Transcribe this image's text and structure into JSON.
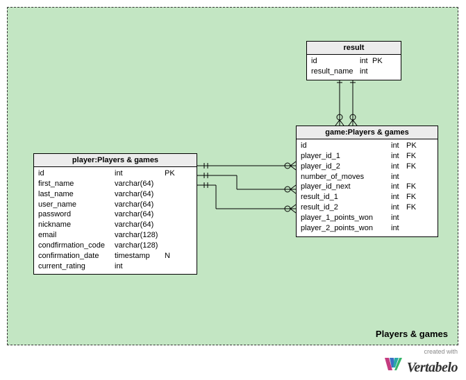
{
  "area": {
    "label": "Players & games"
  },
  "entities": {
    "result": {
      "title": "result",
      "columns": [
        {
          "name": "id",
          "type": "int",
          "flag": "PK"
        },
        {
          "name": "result_name",
          "type": "int",
          "flag": ""
        }
      ]
    },
    "player": {
      "title": "player:Players & games",
      "columns": [
        {
          "name": "id",
          "type": "int",
          "flag": "PK"
        },
        {
          "name": "first_name",
          "type": "varchar(64)",
          "flag": ""
        },
        {
          "name": "last_name",
          "type": "varchar(64)",
          "flag": ""
        },
        {
          "name": "user_name",
          "type": "varchar(64)",
          "flag": ""
        },
        {
          "name": "password",
          "type": "varchar(64)",
          "flag": ""
        },
        {
          "name": "nickname",
          "type": "varchar(64)",
          "flag": ""
        },
        {
          "name": "email",
          "type": "varchar(128)",
          "flag": ""
        },
        {
          "name": "condfirmation_code",
          "type": "varchar(128)",
          "flag": ""
        },
        {
          "name": "confirmation_date",
          "type": "timestamp",
          "flag": "N"
        },
        {
          "name": "current_rating",
          "type": "int",
          "flag": ""
        }
      ]
    },
    "game": {
      "title": "game:Players & games",
      "columns": [
        {
          "name": "id",
          "type": "int",
          "flag": "PK"
        },
        {
          "name": "player_id_1",
          "type": "int",
          "flag": "FK"
        },
        {
          "name": "player_id_2",
          "type": "int",
          "flag": "FK"
        },
        {
          "name": "number_of_moves",
          "type": "int",
          "flag": ""
        },
        {
          "name": "player_id_next",
          "type": "int",
          "flag": "FK"
        },
        {
          "name": "result_id_1",
          "type": "int",
          "flag": "FK"
        },
        {
          "name": "result_id_2",
          "type": "int",
          "flag": "FK"
        },
        {
          "name": "player_1_points_won",
          "type": "int",
          "flag": ""
        },
        {
          "name": "player_2_points_won",
          "type": "int",
          "flag": ""
        }
      ]
    }
  },
  "watermark": {
    "created": "created with",
    "brand": "Vertabelo"
  }
}
